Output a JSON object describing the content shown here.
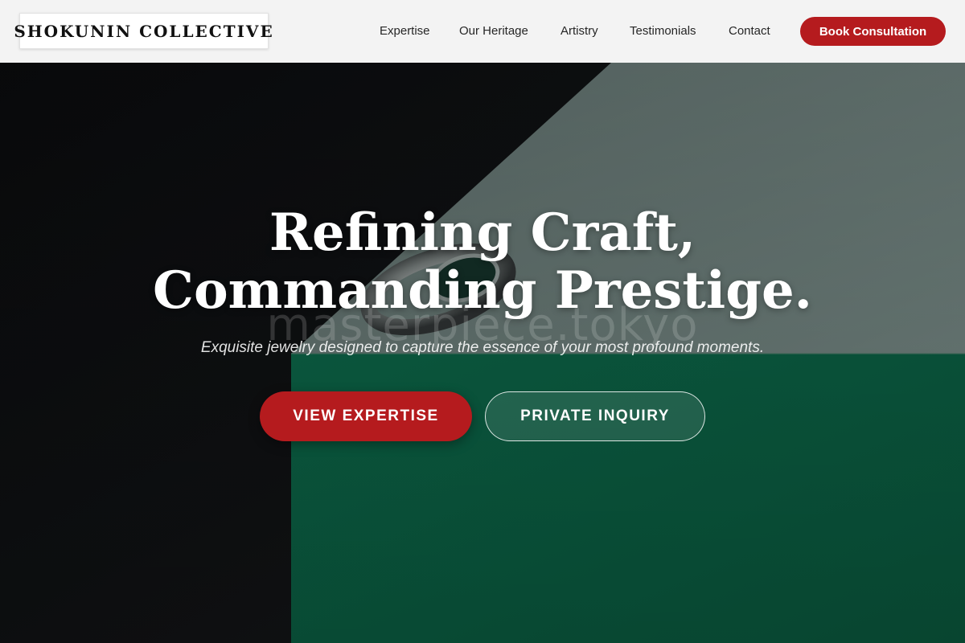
{
  "brand": {
    "name": "SHOKUNIN COLLECTIVE"
  },
  "nav": {
    "items": [
      {
        "label": "Expertise"
      },
      {
        "label": "Our Heritage"
      },
      {
        "label": "Artistry"
      },
      {
        "label": "Testimonials"
      },
      {
        "label": "Contact"
      }
    ],
    "cta_label": "Book Consultation"
  },
  "hero": {
    "title_line1": "Refining Craft,",
    "title_line2": "Commanding Prestige.",
    "watermark": "masterpiece.tokyo",
    "subtitle": "Exquisite jewelry designed to capture the essence of your most profound moments.",
    "primary_button": "VIEW EXPERTISE",
    "secondary_button": "PRIVATE INQUIRY"
  },
  "colors": {
    "accent_red": "#b51b1e",
    "header_bg": "#f3f3f3",
    "felt_green": "#0b6a4a",
    "slate_gray": "#6f8480",
    "shadow_black": "#0b0c0e"
  }
}
